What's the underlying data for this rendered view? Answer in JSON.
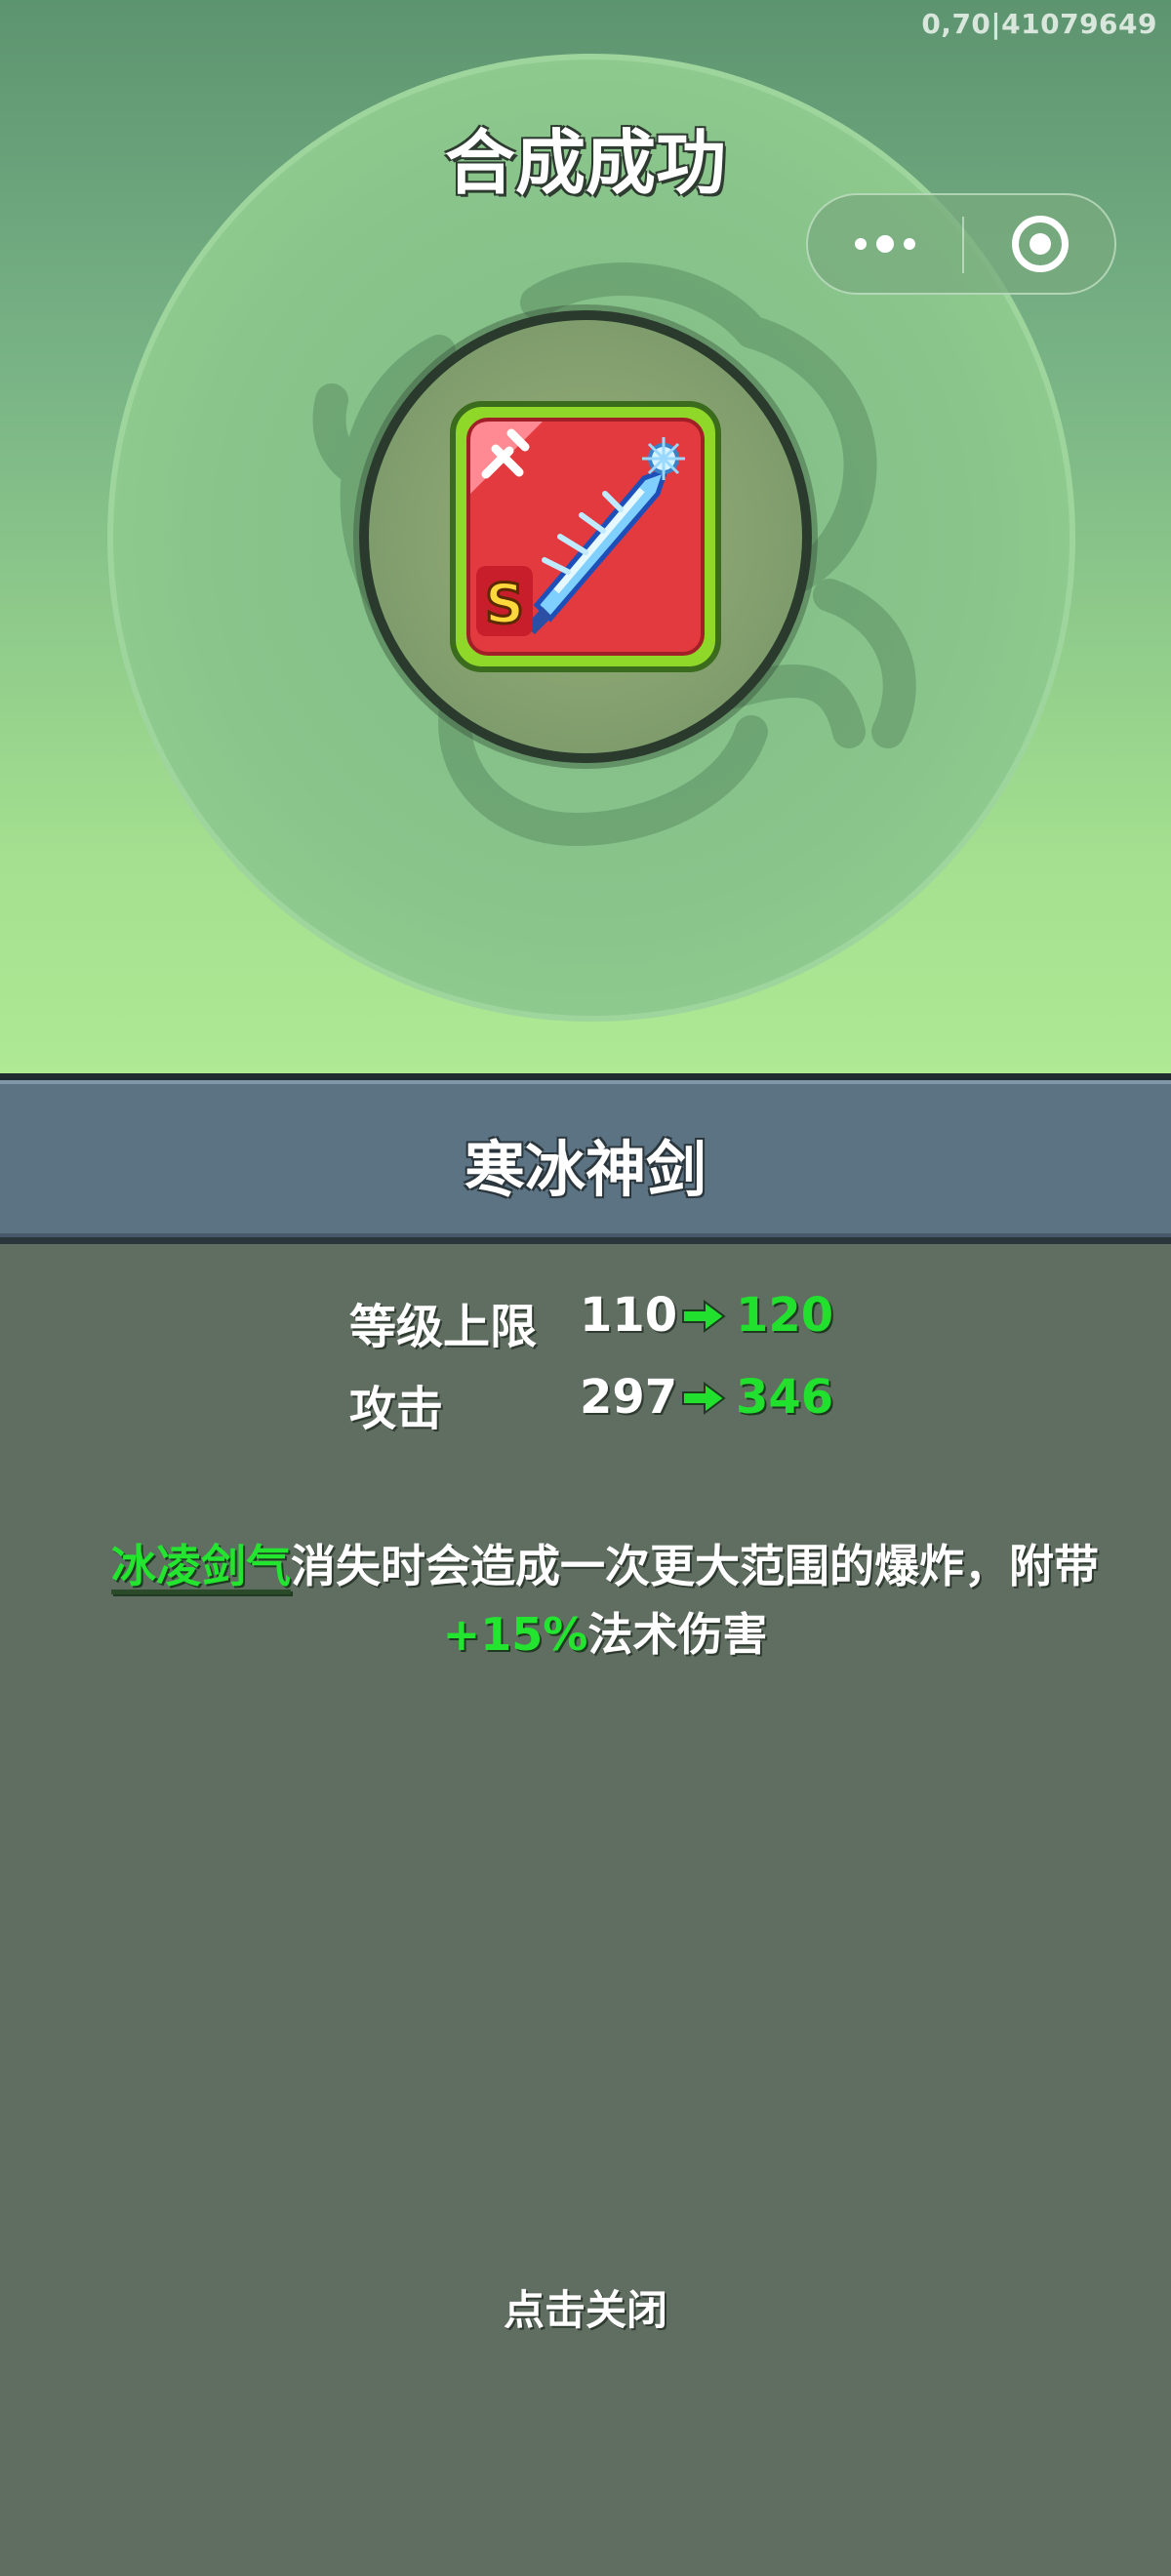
{
  "debug_code": "0,70|41079649",
  "title": "合成成功",
  "item": {
    "name": "寒冰神剑",
    "grade": "S"
  },
  "stats": [
    {
      "label": "等级上限",
      "old": "110",
      "new": "120"
    },
    {
      "label": "攻击",
      "old": "297",
      "new": "346"
    }
  ],
  "effect": {
    "keyword": "冰凌剑气",
    "text_before_pct": "消失时会造成一次更大范围的爆炸，附带",
    "pct": "+15%",
    "text_after_pct": "法术伤害"
  },
  "close_label": "点击关闭",
  "colors": {
    "highlight_green": "#22e02e",
    "card_red": "#e33a3f",
    "card_border_green": "#8fd82a",
    "banner_blue_gray": "#5c7383"
  },
  "icons": {
    "capsule_more": "more-dots-icon",
    "capsule_close": "target-circle-icon",
    "arrow": "right-arrow-icon",
    "item": "ice-sword-icon",
    "weapon_type": "sword-icon"
  }
}
